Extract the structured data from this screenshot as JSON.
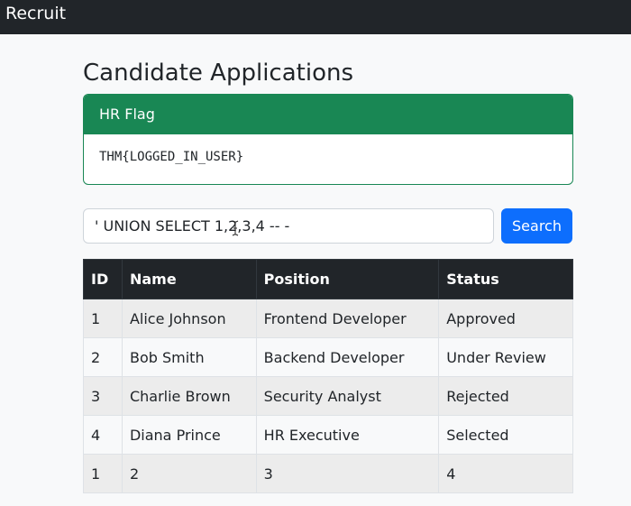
{
  "app": {
    "brand": "Recruit"
  },
  "page": {
    "title": "Candidate Applications"
  },
  "flag_card": {
    "header": "HR Flag",
    "value": "THM{LOGGED_IN_USER}",
    "color": "#198754"
  },
  "search": {
    "value": "' UNION SELECT 1,2,3,4 -- -",
    "button_label": "Search",
    "button_color": "#0d6efd"
  },
  "table": {
    "headers": {
      "id": "ID",
      "name": "Name",
      "position": "Position",
      "status": "Status"
    },
    "rows": [
      {
        "id": "1",
        "name": "Alice Johnson",
        "position": "Frontend Developer",
        "status": "Approved"
      },
      {
        "id": "2",
        "name": "Bob Smith",
        "position": "Backend Developer",
        "status": "Under Review"
      },
      {
        "id": "3",
        "name": "Charlie Brown",
        "position": "Security Analyst",
        "status": "Rejected"
      },
      {
        "id": "4",
        "name": "Diana Prince",
        "position": "HR Executive",
        "status": "Selected"
      },
      {
        "id": "1",
        "name": "2",
        "position": "3",
        "status": "4"
      }
    ]
  },
  "icons": {
    "cursor": "text-cursor-icon"
  }
}
